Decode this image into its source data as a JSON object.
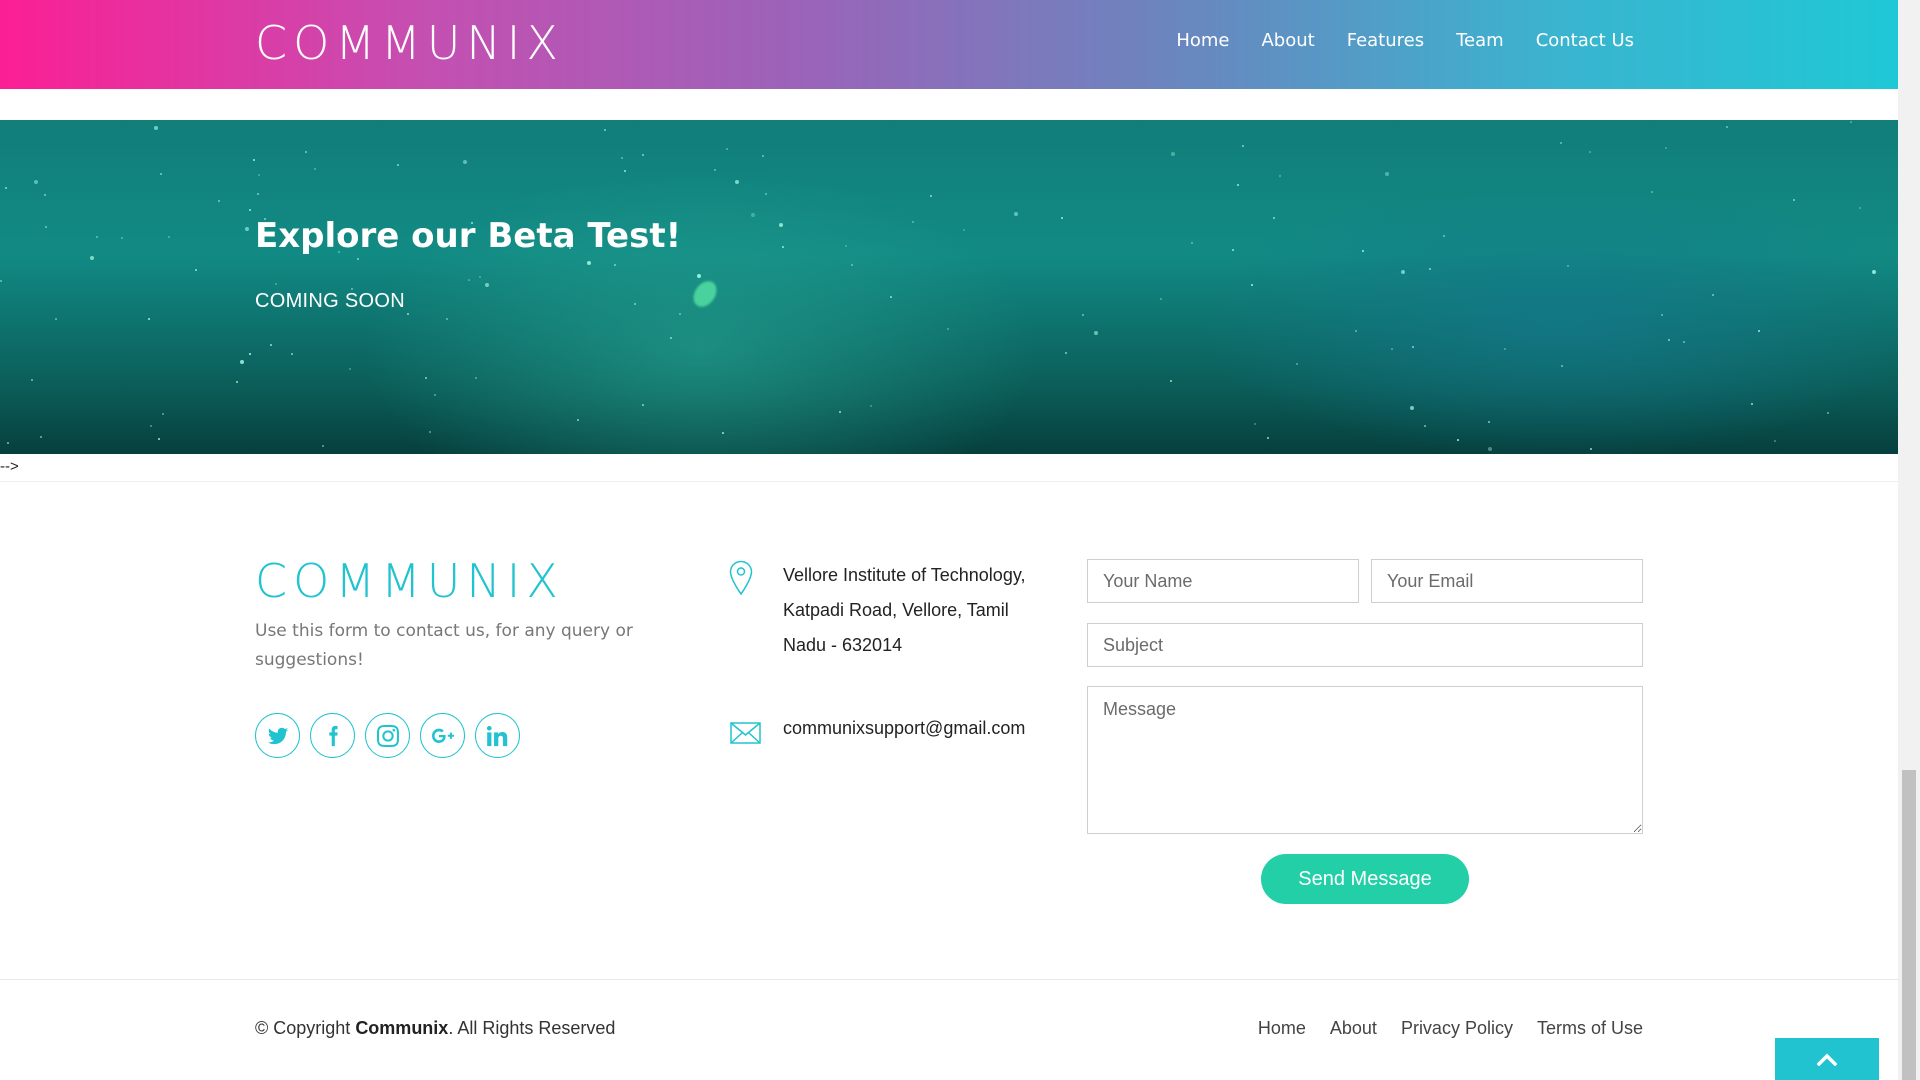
{
  "header": {
    "logo": "COMMUNIX",
    "nav": [
      "Home",
      "About",
      "Features",
      "Team",
      "Contact Us"
    ]
  },
  "banner": {
    "title": "Explore our Beta Test!",
    "subtitle": "COMING SOON"
  },
  "artifact_text": "-->",
  "contact": {
    "logo": "COMMUNIX",
    "description": "Use this form to contact us, for any query or suggestions!",
    "social_icons": [
      "twitter-icon",
      "facebook-icon",
      "instagram-icon",
      "google-plus-icon",
      "linkedin-icon"
    ],
    "address": "Vellore Institute of Technology, Katpadi Road, Vellore, Tamil Nadu - 632014",
    "email": "communixsupport@gmail.com",
    "form": {
      "name_placeholder": "Your Name",
      "email_placeholder": "Your Email",
      "subject_placeholder": "Subject",
      "message_placeholder": "Message",
      "submit_label": "Send Message"
    }
  },
  "footer": {
    "copyright_prefix": "© Copyright ",
    "copyright_brand": "Communix",
    "copyright_suffix": ". All Rights Reserved",
    "links": [
      "Home",
      "About",
      "Privacy Policy",
      "Terms of Use"
    ]
  },
  "colors": {
    "accent": "#20c3cf",
    "button": "#22cfa6",
    "header_gradient_start": "#fb1f94",
    "header_gradient_end": "#1fc8d6"
  }
}
